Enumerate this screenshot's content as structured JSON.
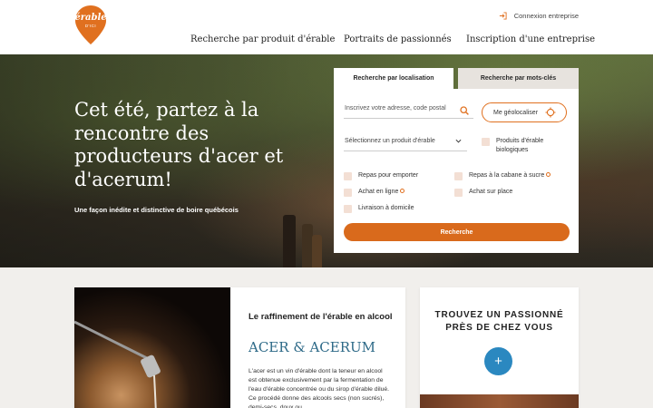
{
  "header": {
    "logo": {
      "name": "érable",
      "sub": "D'ICI",
      "color": "#e0701f"
    },
    "login_label": "Connexion entreprise",
    "nav": [
      {
        "label": "Recherche par produit d'érable"
      },
      {
        "label": "Portraits de passionnés"
      },
      {
        "label": "Inscription d'une entreprise"
      }
    ]
  },
  "hero": {
    "title": "Cet été, partez à la rencontre des producteurs d'acer et d'acerum!",
    "subtitle": "Une façon inédite et distinctive de boire québécois"
  },
  "search": {
    "tabs": [
      {
        "label": "Recherche par localisation",
        "active": true
      },
      {
        "label": "Recherche par mots-clés",
        "active": false
      }
    ],
    "address_placeholder": "Inscrivez votre adresse, code postal",
    "geolocate_label": "Me géolocaliser",
    "product_select": "Sélectionnez un produit d'érable",
    "organic_label": "Produits d'érable biologiques",
    "checkboxes": [
      {
        "label": "Repas pour emporter",
        "info": false,
        "checked": false
      },
      {
        "label": "Repas à la cabane à sucre",
        "info": true,
        "checked": false
      },
      {
        "label": "Achat en ligne",
        "info": true,
        "checked": false
      },
      {
        "label": "Achat sur place",
        "info": false,
        "checked": false
      },
      {
        "label": "Livraison à domicile",
        "info": false,
        "checked": false
      }
    ],
    "submit_label": "Recherche",
    "accent_color": "#d96a1c"
  },
  "feature": {
    "kicker": "Le raffinement de l'érable en alcool",
    "title": "ACER & ACERUM",
    "text": "L'acer est un vin d'érable dont la teneur en alcool est obtenue exclusivement par la fermentation de l'eau d'érable concentrée ou du sirop d'érable dilué. Ce procédé donne des alcools secs (non sucrés), demi-secs, doux ou"
  },
  "finder": {
    "title": "TROUVEZ UN PASSIONNÉ PRÈS DE CHEZ VOUS",
    "button_label": "+",
    "button_color": "#2b88c0"
  }
}
